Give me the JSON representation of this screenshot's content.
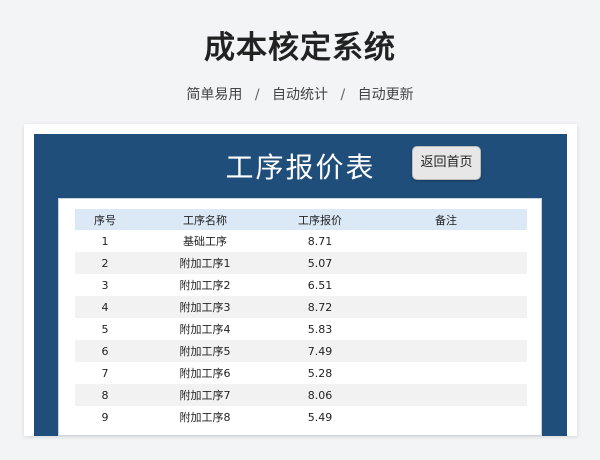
{
  "header": {
    "title": "成本核定系统",
    "tagline": [
      "简单易用",
      "自动统计",
      "自动更新"
    ],
    "separator": "/"
  },
  "panel": {
    "title": "工序报价表",
    "home_button_label": "返回首页",
    "colors": {
      "banner": "#204e7a",
      "header_row": "#dbe8f5",
      "alt_row": "#f2f2f2"
    }
  },
  "table": {
    "columns": [
      "序号",
      "工序名称",
      "工序报价",
      "备注"
    ],
    "rows": [
      [
        "1",
        "基础工序",
        "8.71",
        ""
      ],
      [
        "2",
        "附加工序1",
        "5.07",
        ""
      ],
      [
        "3",
        "附加工序2",
        "6.51",
        ""
      ],
      [
        "4",
        "附加工序3",
        "8.72",
        ""
      ],
      [
        "5",
        "附加工序4",
        "5.83",
        ""
      ],
      [
        "6",
        "附加工序5",
        "7.49",
        ""
      ],
      [
        "7",
        "附加工序6",
        "5.28",
        ""
      ],
      [
        "8",
        "附加工序7",
        "8.06",
        ""
      ],
      [
        "9",
        "附加工序8",
        "5.49",
        ""
      ]
    ]
  }
}
